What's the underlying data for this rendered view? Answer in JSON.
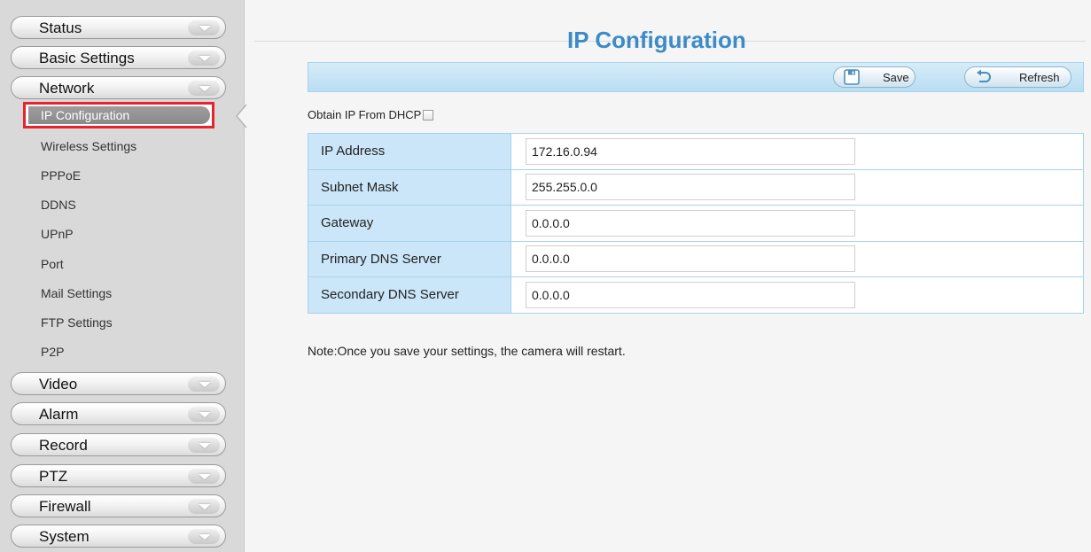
{
  "sidebar": {
    "top_menus": [
      {
        "label": "Status"
      },
      {
        "label": "Basic Settings"
      },
      {
        "label": "Network"
      }
    ],
    "network_items": [
      {
        "label": "IP Configuration",
        "active": true
      },
      {
        "label": "Wireless Settings"
      },
      {
        "label": "PPPoE"
      },
      {
        "label": "DDNS"
      },
      {
        "label": "UPnP"
      },
      {
        "label": "Port"
      },
      {
        "label": "Mail Settings"
      },
      {
        "label": "FTP Settings"
      },
      {
        "label": "P2P"
      }
    ],
    "bottom_menus": [
      {
        "label": "Video"
      },
      {
        "label": "Alarm"
      },
      {
        "label": "Record"
      },
      {
        "label": "PTZ"
      },
      {
        "label": "Firewall"
      },
      {
        "label": "System"
      }
    ]
  },
  "main": {
    "title": "IP Configuration",
    "toolbar": {
      "save_label": "Save",
      "refresh_label": "Refresh"
    },
    "dhcp_label": "Obtain IP From DHCP",
    "dhcp_checked": false,
    "fields": [
      {
        "label": "IP Address",
        "value": "172.16.0.94"
      },
      {
        "label": "Subnet Mask",
        "value": "255.255.0.0"
      },
      {
        "label": "Gateway",
        "value": "0.0.0.0"
      },
      {
        "label": "Primary DNS Server",
        "value": "0.0.0.0"
      },
      {
        "label": "Secondary DNS Server",
        "value": "0.0.0.0"
      }
    ],
    "note": "Note:Once you save your settings, the camera will restart."
  },
  "colors": {
    "title_blue": "#3c8bc8",
    "toolbar_blue": "#c6e4f6",
    "label_cell_blue": "#cbe6f8",
    "active_highlight_red": "#e8232c",
    "sidebar_gray": "#d9d9d9"
  },
  "icons": {
    "save": "floppy-disk-icon",
    "refresh": "refresh-arrow-icon",
    "menu_expand": "chevron-down-icon"
  }
}
